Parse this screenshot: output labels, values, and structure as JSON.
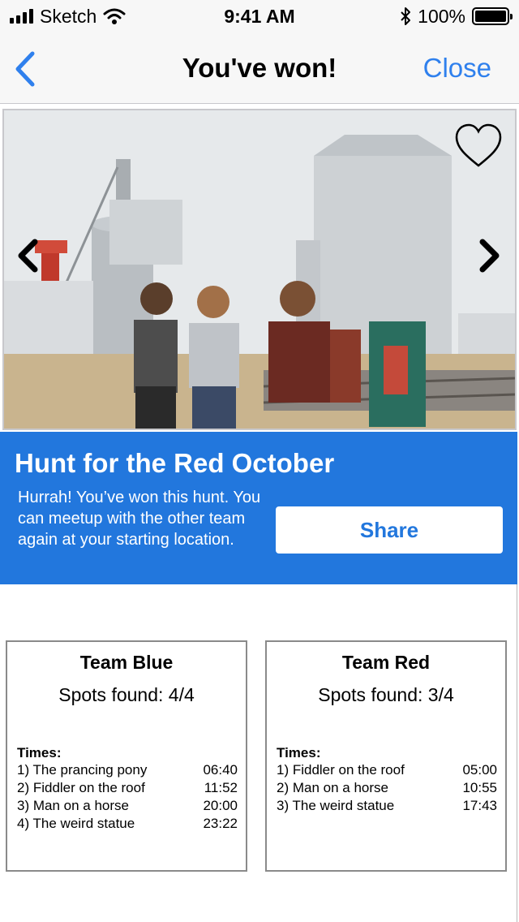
{
  "status_bar": {
    "carrier": "Sketch",
    "time": "9:41 AM",
    "battery_pct": "100%",
    "icons": [
      "signal-icon",
      "wifi-icon",
      "bluetooth-icon",
      "battery-icon"
    ]
  },
  "nav": {
    "title": "You've won!",
    "close_label": "Close",
    "back_icon": "chevron-left-icon"
  },
  "hero": {
    "icons": [
      "heart-icon",
      "arrow-left-icon",
      "arrow-right-icon"
    ]
  },
  "banner": {
    "title": "Hunt for the Red October",
    "message": "Hurrah! You’ve won this hunt. You can  meetup with the other team again at your starting location.",
    "share_label": "Share"
  },
  "teams": [
    {
      "name": "Team Blue",
      "spots": "Spots found: 4/4",
      "times_label": "Times:",
      "times": [
        {
          "spot": "1) The prancing pony",
          "time": "06:40"
        },
        {
          "spot": "2) Fiddler on the roof",
          "time": "11:52"
        },
        {
          "spot": "3) Man on a horse",
          "time": "20:00"
        },
        {
          "spot": "4) The weird statue",
          "time": "23:22"
        }
      ]
    },
    {
      "name": "Team Red",
      "spots": "Spots found: 3/4",
      "times_label": "Times:",
      "times": [
        {
          "spot": "1) Fiddler on the roof",
          "time": "05:00"
        },
        {
          "spot": "2) Man on a horse",
          "time": "10:55"
        },
        {
          "spot": "3) The weird statue",
          "time": "17:43"
        }
      ]
    }
  ],
  "colors": {
    "accent": "#2f80ed",
    "banner": "#2277dd",
    "bar_background": "#f7f7f7"
  }
}
